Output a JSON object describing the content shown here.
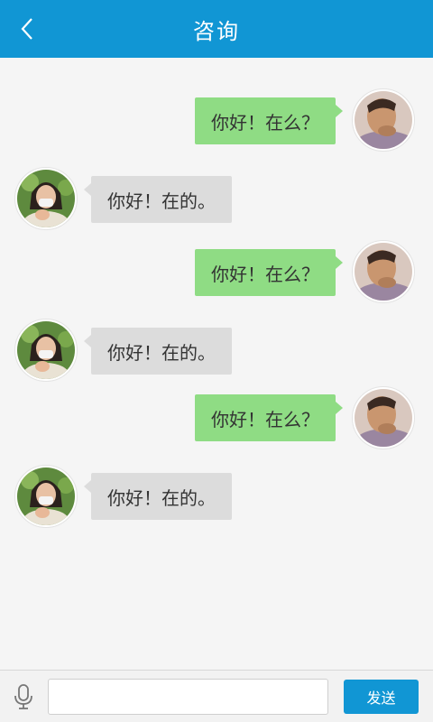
{
  "header": {
    "title": "咨询",
    "back_icon": "chevron-left-icon",
    "bg_color": "#1196d4"
  },
  "messages": [
    {
      "side": "me",
      "text": "你好！在么？"
    },
    {
      "side": "other",
      "text": "你好！在的。"
    },
    {
      "side": "me",
      "text": "你好！在么？"
    },
    {
      "side": "other",
      "text": "你好！在的。"
    },
    {
      "side": "me",
      "text": "你好！在么？"
    },
    {
      "side": "other",
      "text": "你好！在的。"
    }
  ],
  "colors": {
    "me_bubble": "#8fdc84",
    "other_bubble": "#dcdcdc",
    "background": "#f5f5f5"
  },
  "input_bar": {
    "mic_icon": "microphone-icon",
    "input_value": "",
    "send_label": "发送"
  }
}
